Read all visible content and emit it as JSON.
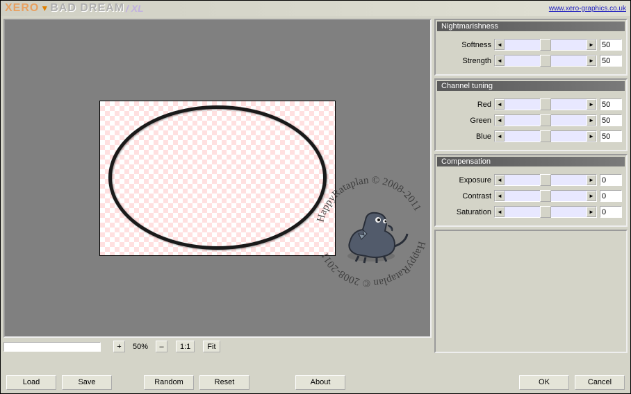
{
  "titlebar": {
    "brand_xero": "XERO",
    "product": "BAD DREAM",
    "xl": "/ XL",
    "url": "www.xero-graphics.co.uk"
  },
  "watermark": {
    "text1": "HappyRataplan © 2008-2011",
    "text2": "HappyRataplan © 2008-2011"
  },
  "zoom": {
    "plus": "+",
    "minus": "–",
    "percent": "50%",
    "oneone": "1:1",
    "fit": "Fit"
  },
  "panels": {
    "nightmarishness": {
      "title": "Nightmarishness",
      "softness": {
        "label": "Softness",
        "value": "50",
        "pos": 50
      },
      "strength": {
        "label": "Strength",
        "value": "50",
        "pos": 50
      }
    },
    "channel": {
      "title": "Channel tuning",
      "red": {
        "label": "Red",
        "value": "50",
        "pos": 50
      },
      "green": {
        "label": "Green",
        "value": "50",
        "pos": 50
      },
      "blue": {
        "label": "Blue",
        "value": "50",
        "pos": 50
      }
    },
    "compensation": {
      "title": "Compensation",
      "exposure": {
        "label": "Exposure",
        "value": "0",
        "pos": 50
      },
      "contrast": {
        "label": "Contrast",
        "value": "0",
        "pos": 50
      },
      "saturation": {
        "label": "Saturation",
        "value": "0",
        "pos": 50
      }
    }
  },
  "buttons": {
    "load": "Load",
    "save": "Save",
    "random": "Random",
    "reset": "Reset",
    "about": "About",
    "ok": "OK",
    "cancel": "Cancel"
  }
}
